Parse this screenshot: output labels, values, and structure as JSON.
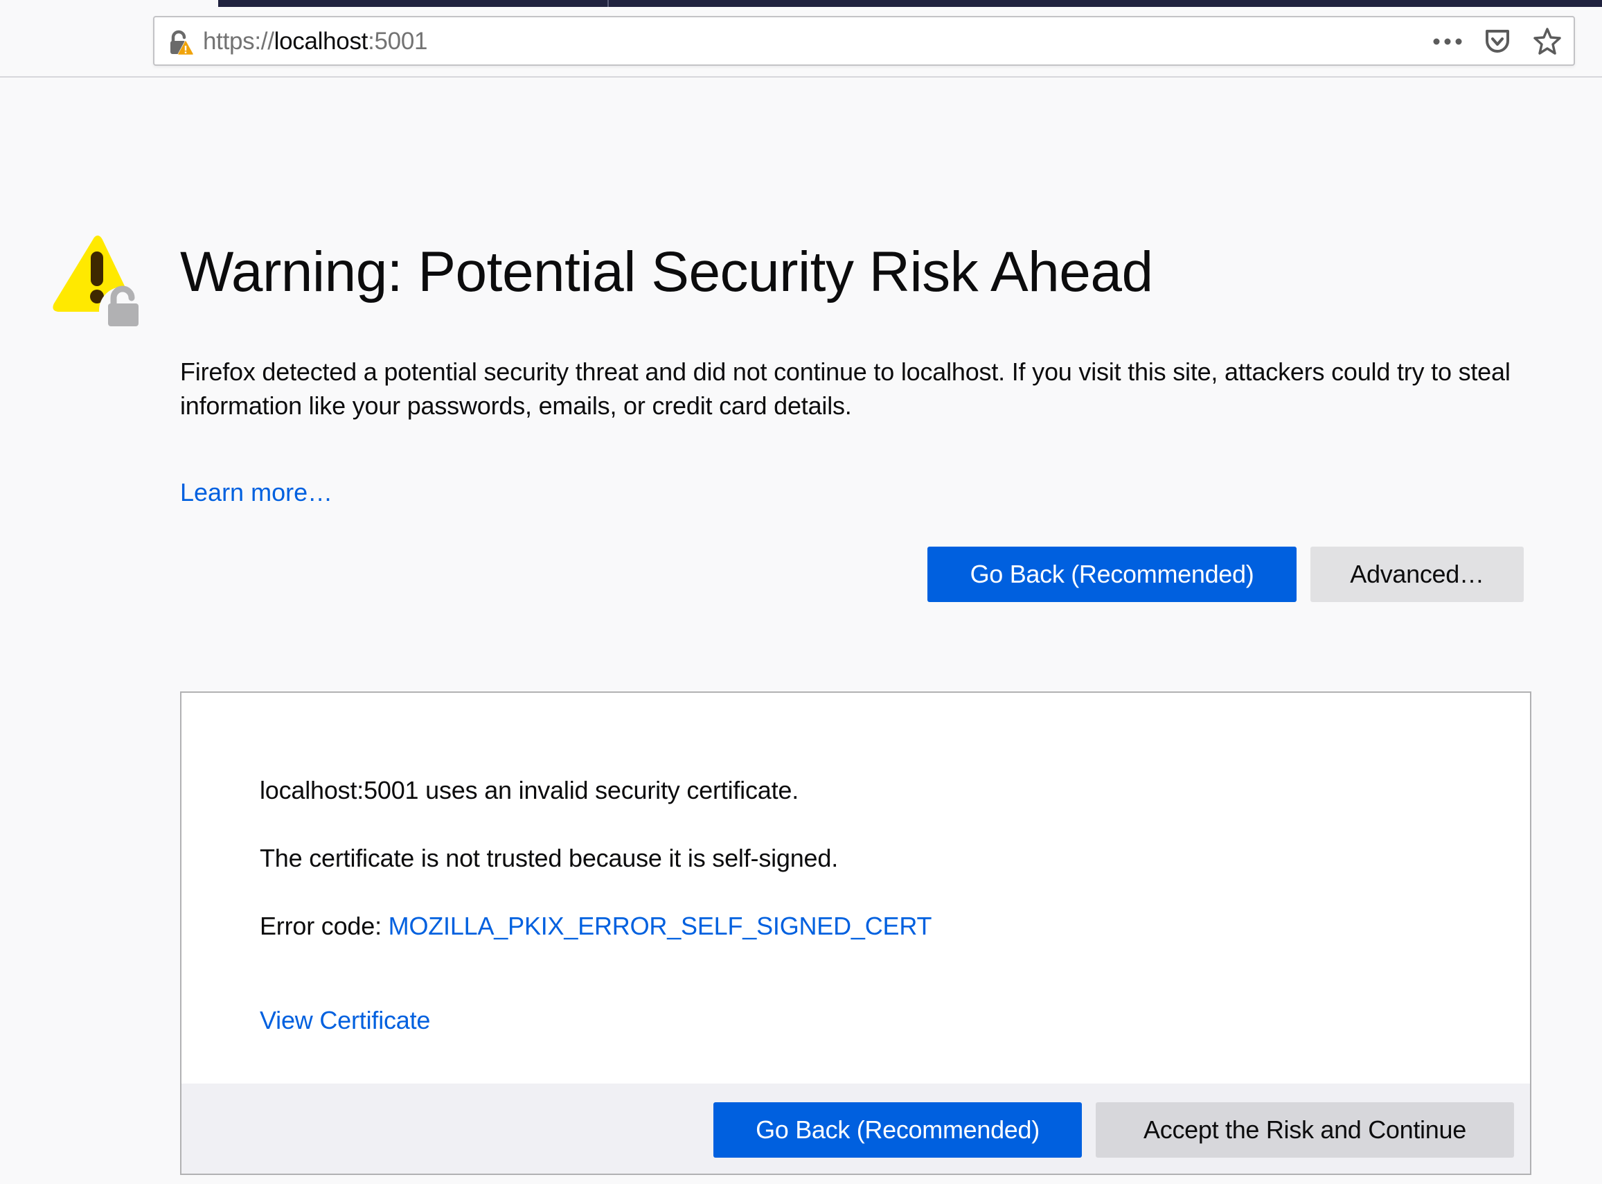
{
  "browser": {
    "url": {
      "scheme": "https://",
      "host": "localhost",
      "port": ":5001"
    },
    "icons": {
      "security": "insecure-lock-warning-icon",
      "page_actions": "more-dots-icon",
      "pocket": "pocket-icon",
      "bookmark": "star-icon"
    },
    "page_actions_label": "•••"
  },
  "error_page": {
    "icon": "warning-lock-icon",
    "title": "Warning: Potential Security Risk Ahead",
    "intro": "Firefox detected a potential security threat and did not continue to localhost. If you visit this site, attackers could try to steal information like your passwords, emails, or credit card details.",
    "learn_more": "Learn more…",
    "buttons": {
      "go_back": "Go Back (Recommended)",
      "advanced": "Advanced…"
    },
    "advanced_panel": {
      "line1": "localhost:5001 uses an invalid security certificate.",
      "line2": "The certificate is not trusted because it is self-signed.",
      "error_code_label": "Error code: ",
      "error_code": "MOZILLA_PKIX_ERROR_SELF_SIGNED_CERT",
      "view_certificate": "View Certificate",
      "buttons": {
        "go_back": "Go Back (Recommended)",
        "accept": "Accept the Risk and Continue"
      }
    }
  },
  "colors": {
    "accent_blue": "#0060df",
    "warning_yellow": "#ffe900",
    "background": "#f9f9fa",
    "topbar": "#20223f"
  }
}
